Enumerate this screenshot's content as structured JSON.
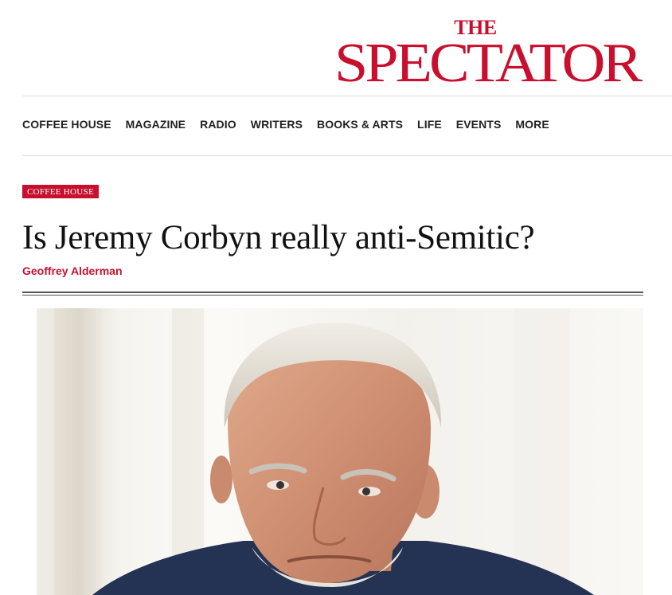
{
  "masthead": {
    "logo_the": "THE",
    "logo_main": "SPECTATOR",
    "brand_color": "#c8102e"
  },
  "nav": {
    "items": [
      "COFFEE HOUSE",
      "MAGAZINE",
      "RADIO",
      "WRITERS",
      "BOOKS & ARTS",
      "LIFE",
      "EVENTS",
      "MORE"
    ]
  },
  "article": {
    "section_tag": "COFFEE HOUSE",
    "headline": "Is Jeremy Corbyn really anti-Semitic?",
    "author": "Geoffrey Alderman"
  },
  "image": {
    "subject": "portrait photo"
  }
}
